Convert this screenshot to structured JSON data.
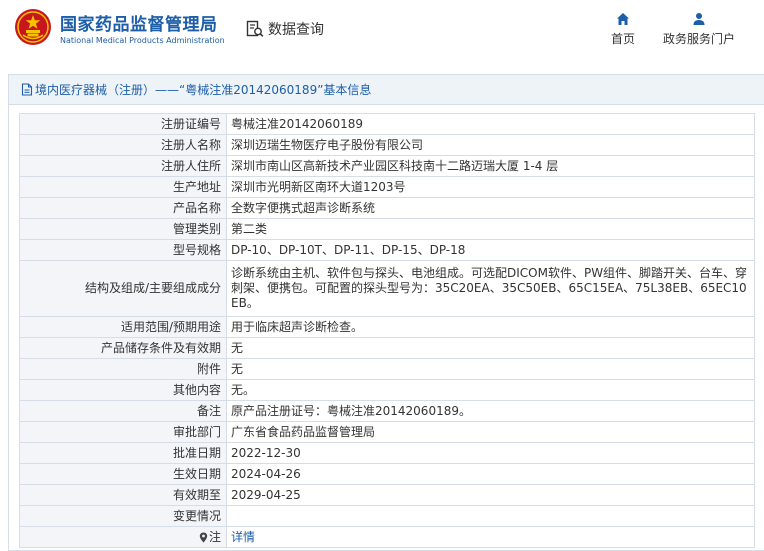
{
  "header": {
    "site_name": "国家药品监督管理局",
    "site_name_en": "National Medical Products Administration",
    "data_query": "数据查询",
    "nav": {
      "home": "首页",
      "service": "政务服务门户"
    }
  },
  "panel": {
    "title": "境内医疗器械（注册）——“粤械注准20142060189”基本信息"
  },
  "rows": [
    {
      "label": "注册证编号",
      "value": "粤械注准20142060189"
    },
    {
      "label": "注册人名称",
      "value": "深圳迈瑞生物医疗电子股份有限公司"
    },
    {
      "label": "注册人住所",
      "value": "深圳市南山区高新技术产业园区科技南十二路迈瑞大厦 1-4 层"
    },
    {
      "label": "生产地址",
      "value": "深圳市光明新区南环大道1203号"
    },
    {
      "label": "产品名称",
      "value": "全数字便携式超声诊断系统"
    },
    {
      "label": "管理类别",
      "value": "第二类"
    },
    {
      "label": "型号规格",
      "value": "DP-10、DP-10T、DP-11、DP-15、DP-18"
    },
    {
      "label": "结构及组成/主要组成成分",
      "value": "诊断系统由主机、软件包与探头、电池组成。可选配DICOM软件、PW组件、脚踏开关、台车、穿刺架、便携包。可配置的探头型号为：35C20EA、35C50EB、65C15EA、75L38EB、65EC10EB。"
    },
    {
      "label": "适用范围/预期用途",
      "value": "用于临床超声诊断检查。"
    },
    {
      "label": "产品储存条件及有效期",
      "value": "无"
    },
    {
      "label": "附件",
      "value": "无"
    },
    {
      "label": "其他内容",
      "value": "无。"
    },
    {
      "label": "备注",
      "value": "原产品注册证号：粤械注准20142060189。"
    },
    {
      "label": "审批部门",
      "value": "广东省食品药品监督管理局"
    },
    {
      "label": "批准日期",
      "value": "2022-12-30"
    },
    {
      "label": "生效日期",
      "value": "2024-04-26"
    },
    {
      "label": "有效期至",
      "value": "2029-04-25"
    },
    {
      "label": "变更情况",
      "value": ""
    }
  ],
  "note_row": {
    "label": "注",
    "link": "详情"
  },
  "colors": {
    "brand_blue": "#1d5ea8",
    "border": "#d6dde6",
    "label_bg": "#f3f5f8",
    "title_bg": "#eef3f8",
    "emblem_red": "#c8161d",
    "emblem_gold": "#f5c400"
  },
  "icons": {
    "logo": "national-emblem-icon",
    "data_query": "search-document-icon",
    "home": "home-icon",
    "service": "user-icon",
    "panel": "document-icon",
    "note": "location-pin-icon"
  }
}
